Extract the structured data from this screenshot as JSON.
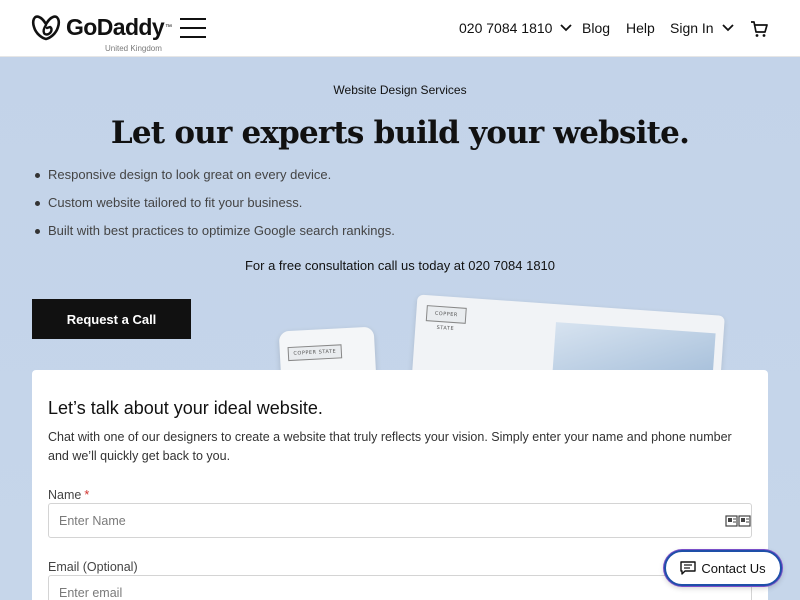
{
  "header": {
    "brand": "GoDaddy",
    "brand_tm": "™",
    "region": "United Kingdom",
    "phone": "020 7084 1810",
    "blog": "Blog",
    "help": "Help",
    "sign_in": "Sign In",
    "icons": [
      "godaddy-logo-icon",
      "hamburger-menu-icon",
      "chevron-down-icon",
      "cart-icon"
    ]
  },
  "hero": {
    "eyebrow": "Website Design Services",
    "title": "Let our experts build your website.",
    "bullets": [
      "Responsive design to look great on every device.",
      "Custom website tailored to fit your business.",
      "Built with best practices to optimize Google search rankings."
    ],
    "consultation": "For a free consultation call us today at 020 7084 1810",
    "cta_label": "Request a Call",
    "background_color": "#c4d4ea",
    "mock_brand": "COPPER STATE"
  },
  "form": {
    "title": "Let’s talk about your ideal website.",
    "description": "Chat with one of our designers to create a website that truly reflects your vision. Simply enter your name and phone number and we’ll quickly get back to you.",
    "name_label": "Name",
    "required_mark": "*",
    "name_placeholder": "Enter Name",
    "email_label": "Email (Optional)",
    "email_placeholder": "Enter email"
  },
  "chat": {
    "label": "Contact Us",
    "icon": "chat-bubble-icon",
    "border_color": "#1e4fa8"
  }
}
